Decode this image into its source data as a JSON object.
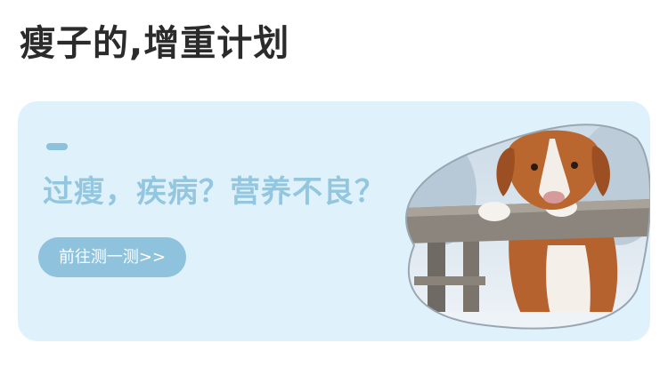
{
  "page": {
    "title": "瘦子的,增重计划"
  },
  "banner": {
    "headline": "过瘦，疾病？营养不良？",
    "cta_label": "前往测一测>>",
    "image_name": "dog-on-fence-photo",
    "colors": {
      "background": "#dff2fc",
      "accent": "#8fc3dd",
      "headline_text": "#93c6df"
    }
  }
}
